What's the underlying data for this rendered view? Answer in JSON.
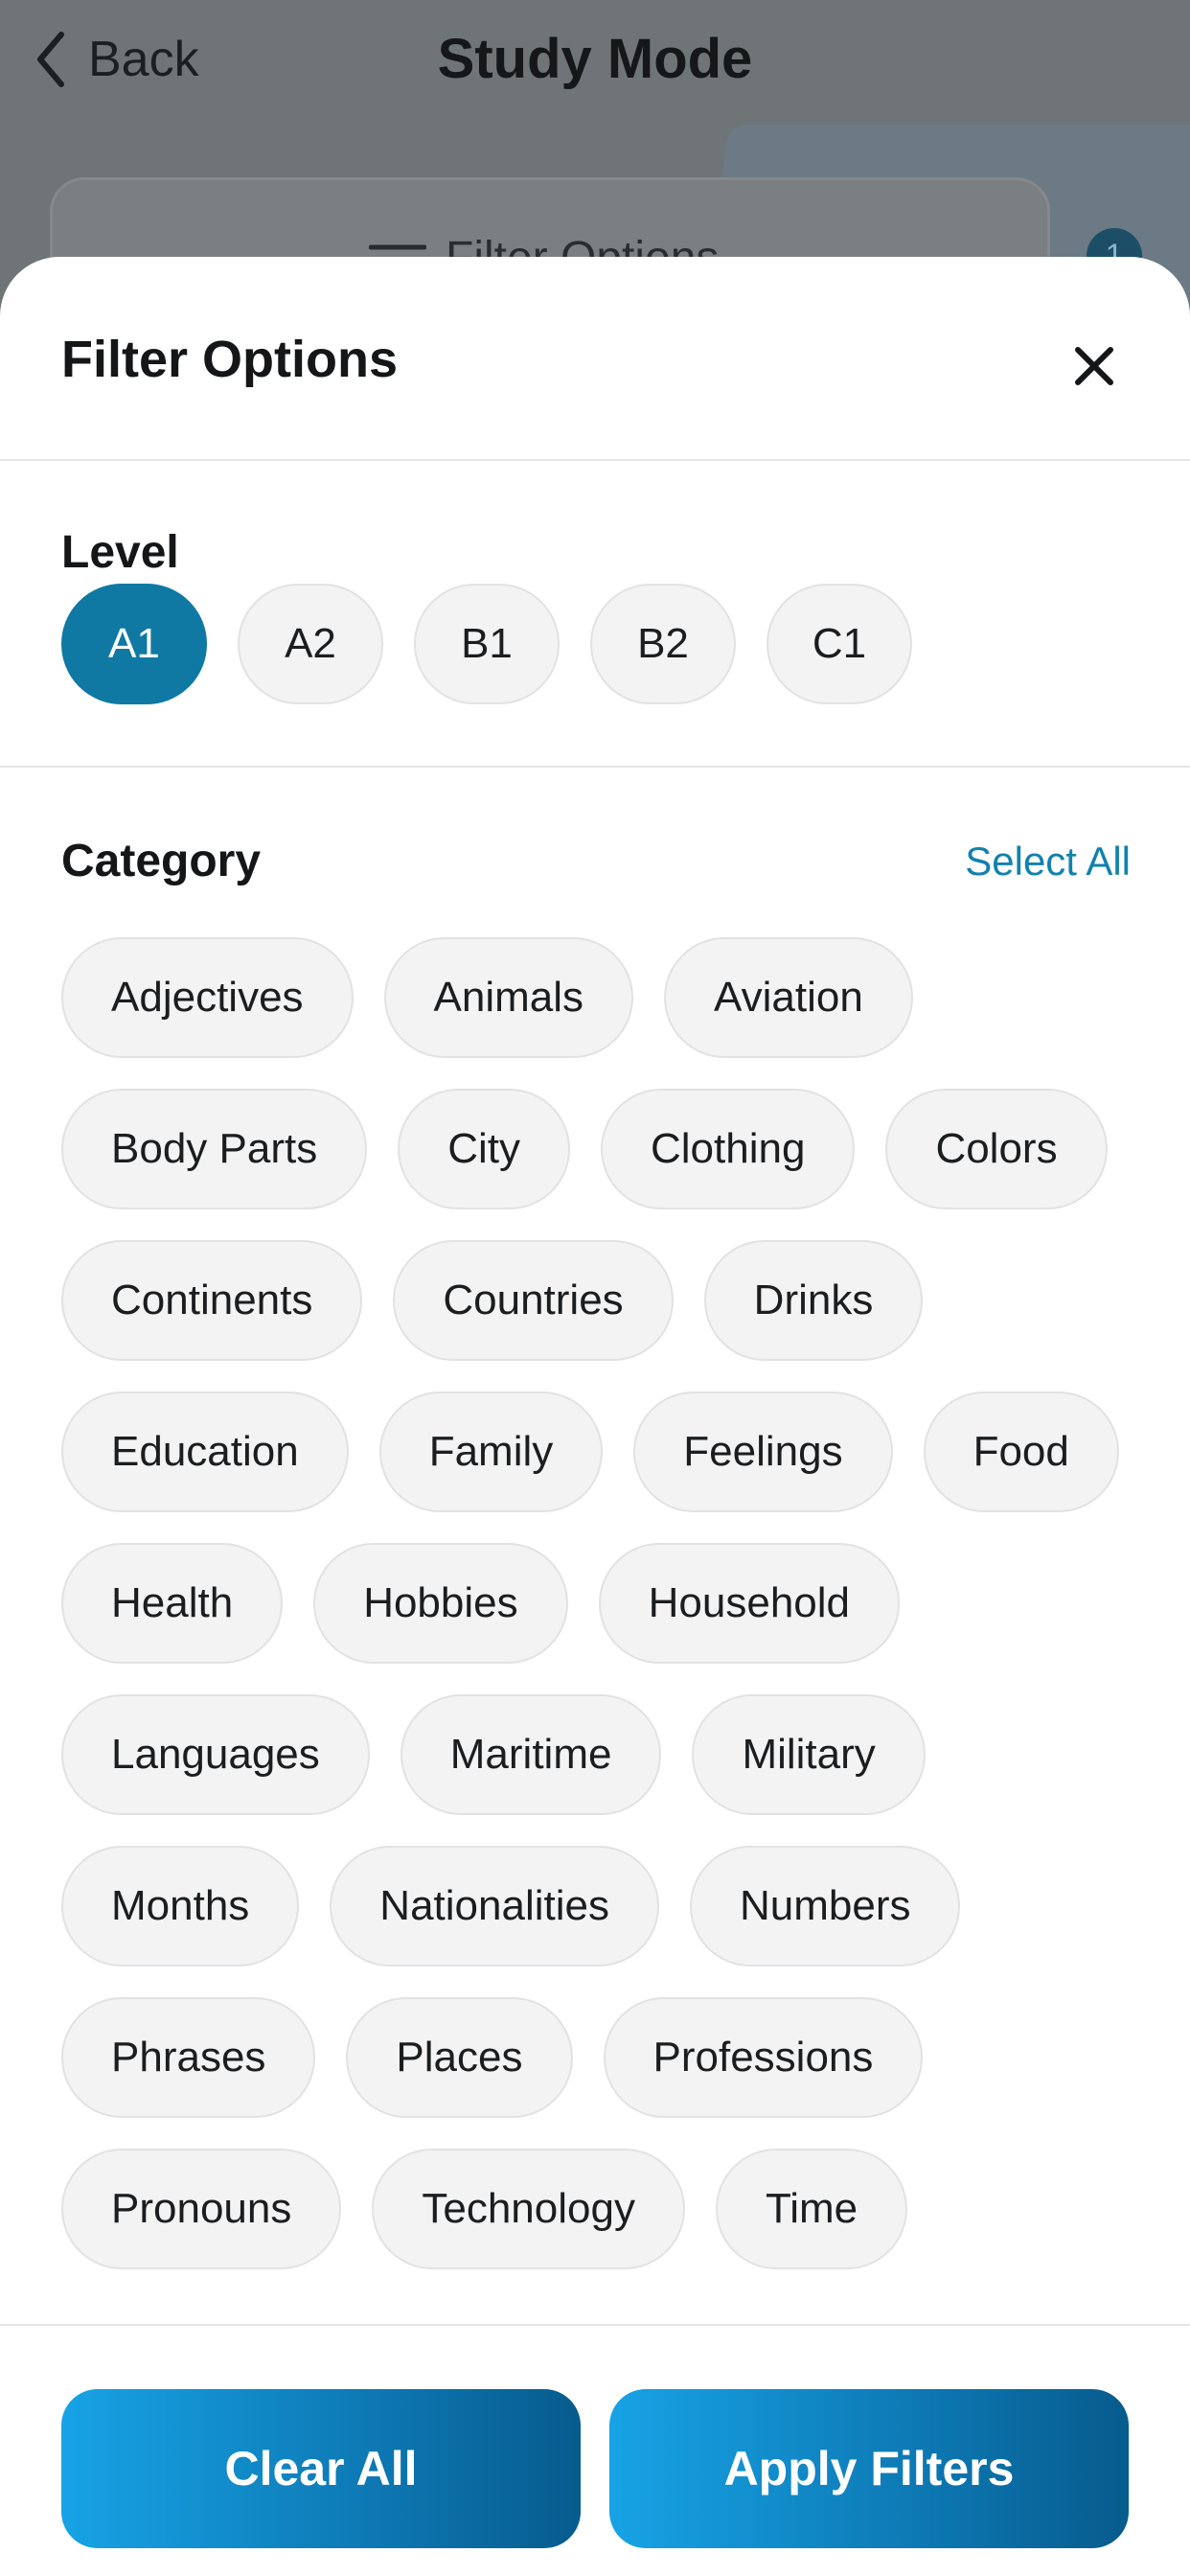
{
  "nav": {
    "back_label": "Back",
    "title": "Study Mode"
  },
  "background": {
    "filter_button_label": "Filter Options",
    "badge_count": "1"
  },
  "sheet": {
    "title": "Filter Options",
    "level": {
      "label": "Level",
      "options": [
        "A1",
        "A2",
        "B1",
        "B2",
        "C1"
      ],
      "selected": "A1"
    },
    "category": {
      "label": "Category",
      "select_all_label": "Select All",
      "rows": [
        [
          "Adjectives",
          "Animals",
          "Aviation"
        ],
        [
          "Body Parts",
          "City",
          "Clothing",
          "Colors"
        ],
        [
          "Continents",
          "Countries",
          "Drinks"
        ],
        [
          "Education",
          "Family",
          "Feelings",
          "Food"
        ],
        [
          "Health",
          "Hobbies",
          "Household"
        ],
        [
          "Languages",
          "Maritime",
          "Military"
        ],
        [
          "Months",
          "Nationalities",
          "Numbers"
        ],
        [
          "Phrases",
          "Places",
          "Professions"
        ],
        [
          "Pronouns",
          "Technology",
          "Time"
        ]
      ]
    }
  },
  "footer": {
    "clear_label": "Clear All",
    "apply_label": "Apply Filters"
  },
  "colors": {
    "accent": "#0f79a4",
    "link": "#1182ad",
    "chip_bg": "#f3f3f4",
    "button_gradient_start": "#17a3e6",
    "button_gradient_end": "#075b8d"
  }
}
